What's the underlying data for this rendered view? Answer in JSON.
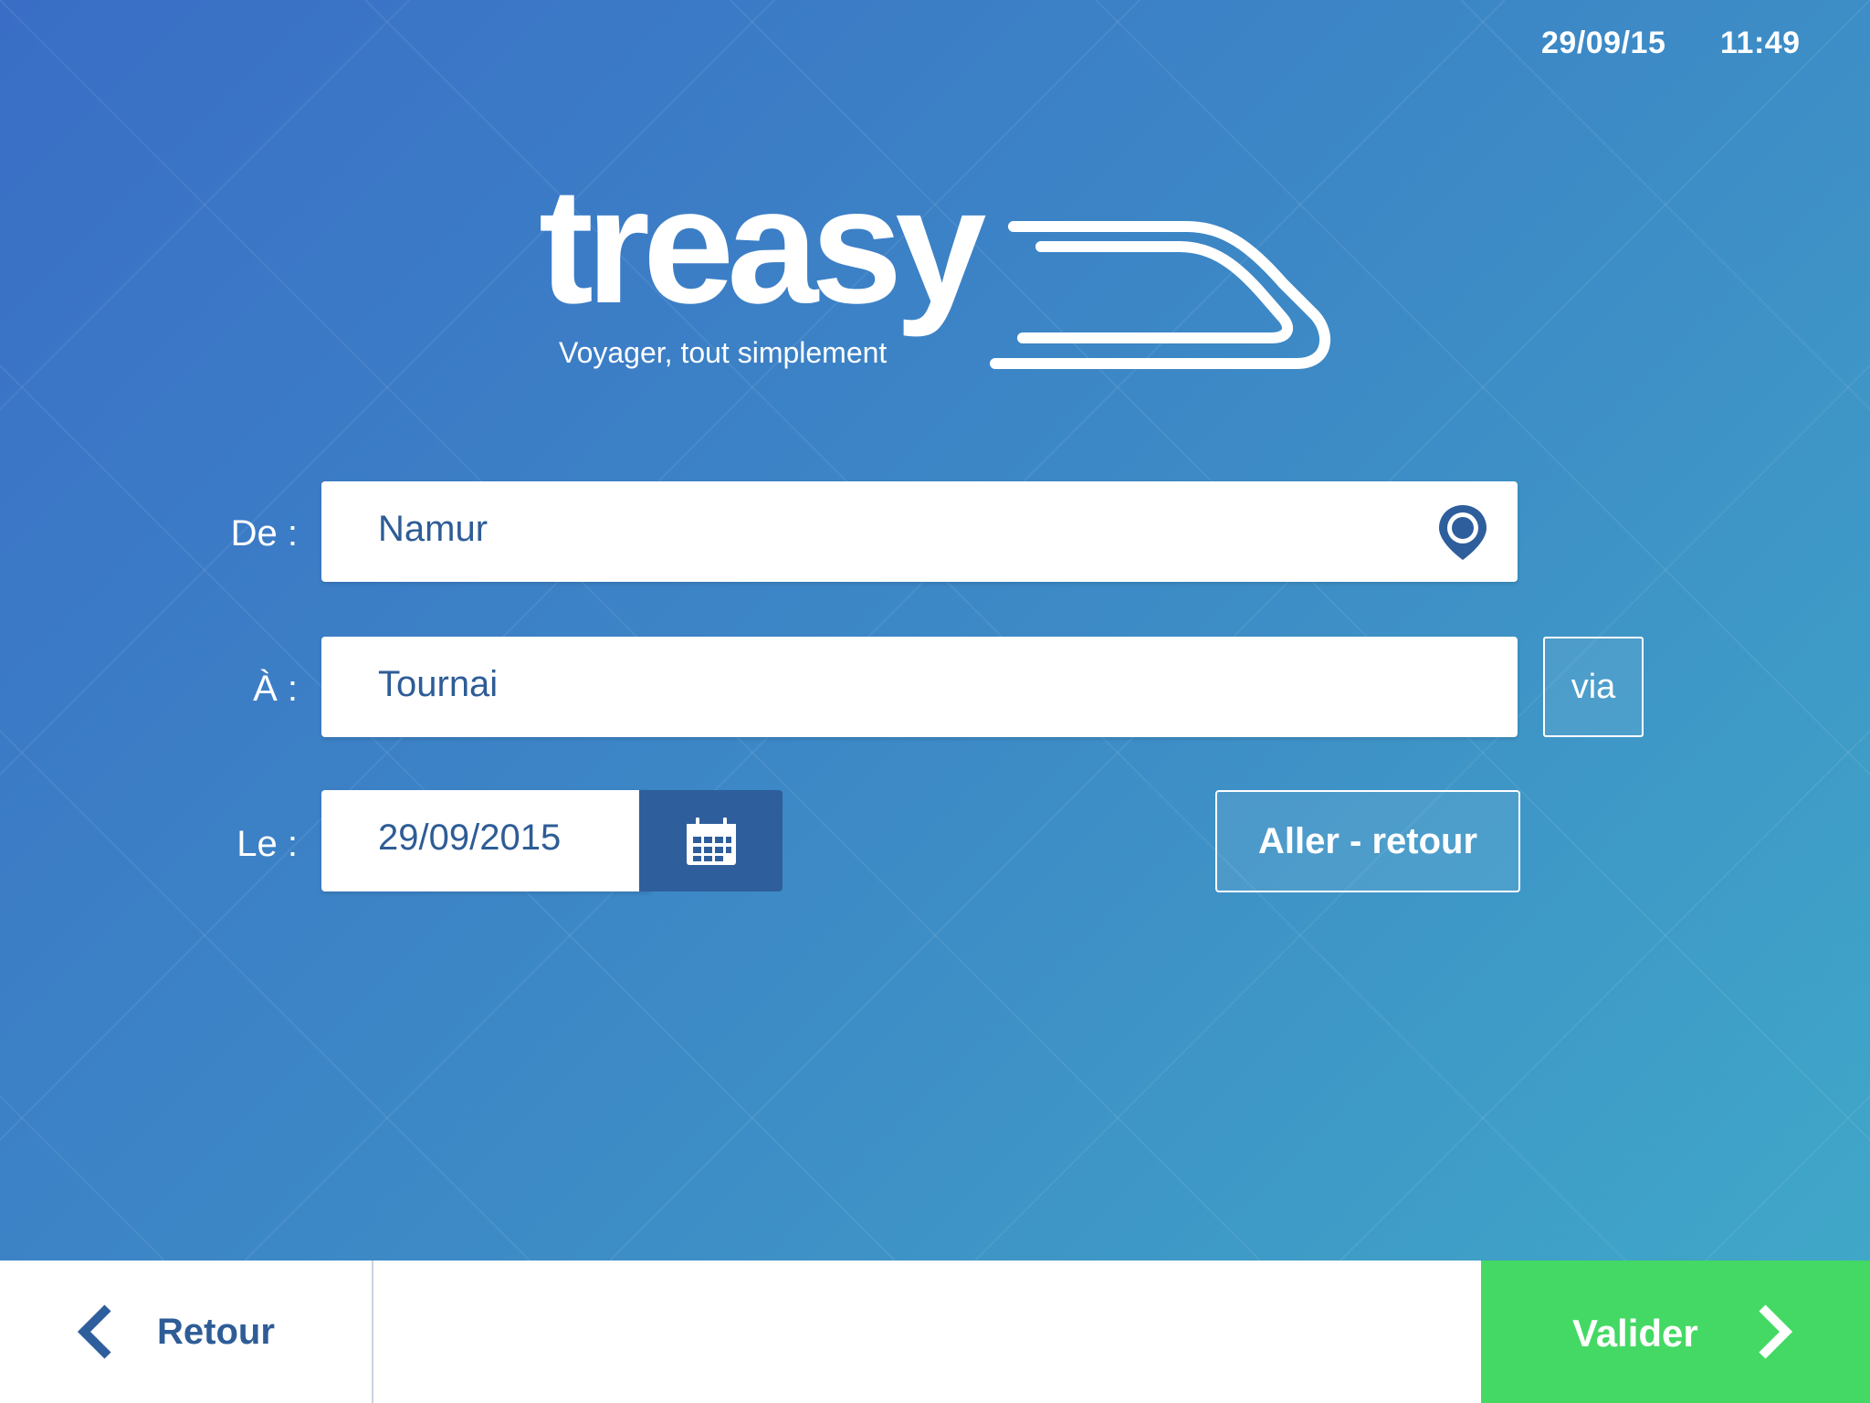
{
  "status": {
    "date": "29/09/15",
    "time": "11:49"
  },
  "logo": {
    "wordmark": "treasy",
    "tagline": "Voyager, tout simplement"
  },
  "form": {
    "from_label": "De :",
    "from_value": "Namur",
    "to_label": "À :",
    "to_value": "Tournai",
    "via_label": "via",
    "date_label": "Le :",
    "date_value": "29/09/2015",
    "roundtrip_label": "Aller - retour"
  },
  "bottom_bar": {
    "back_label": "Retour",
    "confirm_label": "Valider"
  },
  "colors": {
    "accent_dark": "#2f5e9c",
    "confirm_green": "#44d964",
    "text_blue": "#2e5c96"
  },
  "icons": {
    "location": "location-pin-icon",
    "calendar": "calendar-icon",
    "back": "chevron-left-icon",
    "confirm": "chevron-right-icon"
  }
}
